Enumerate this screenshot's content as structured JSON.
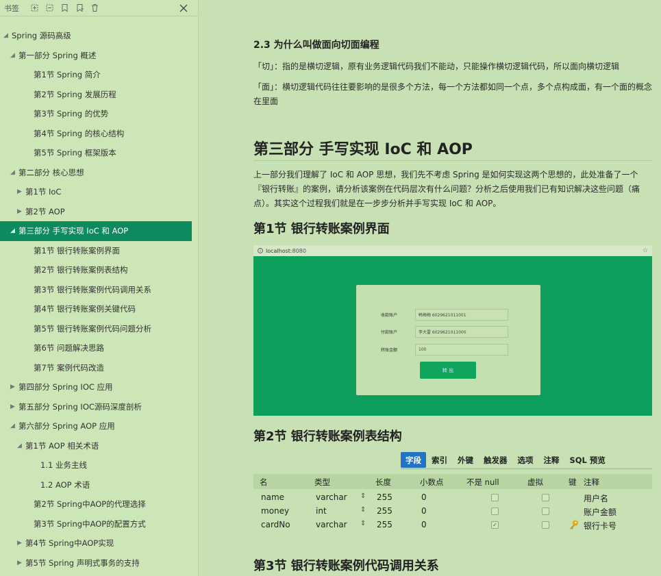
{
  "sidebar": {
    "title": "书签",
    "toolbar_icons": [
      "expand-all-icon",
      "collapse-all-icon",
      "add-bookmark-icon",
      "add-child-bookmark-icon",
      "delete-bookmark-icon"
    ],
    "items": [
      {
        "label": "Spring 源码高级",
        "caret": "◢",
        "level": "lvl0"
      },
      {
        "label": "第一部分 Spring 概述",
        "caret": "◢",
        "level": "lvl1"
      },
      {
        "label": "第1节 Spring 简介",
        "caret": "",
        "level": "lvl2"
      },
      {
        "label": "第2节 Spring 发展历程",
        "caret": "",
        "level": "lvl2"
      },
      {
        "label": "第3节 Spring 的优势",
        "caret": "",
        "level": "lvl2"
      },
      {
        "label": "第4节 Spring 的核心结构",
        "caret": "",
        "level": "lvl2"
      },
      {
        "label": "第5节 Spring 框架版本",
        "caret": "",
        "level": "lvl2"
      },
      {
        "label": "第二部分 核心思想",
        "caret": "◢",
        "level": "lvl1"
      },
      {
        "label": "第1节 IoC",
        "caret": "▶",
        "level": "lvl2c"
      },
      {
        "label": "第2节 AOP",
        "caret": "▶",
        "level": "lvl2c"
      },
      {
        "label": "第三部分 手写实现 IoC 和 AOP",
        "caret": "◢",
        "level": "lvl1",
        "active": true
      },
      {
        "label": "第1节 银行转账案例界面",
        "caret": "",
        "level": "lvl2"
      },
      {
        "label": "第2节 银行转账案例表结构",
        "caret": "",
        "level": "lvl2"
      },
      {
        "label": "第3节 银行转账案例代码调用关系",
        "caret": "",
        "level": "lvl2"
      },
      {
        "label": "第4节 银行转账案例关键代码",
        "caret": "",
        "level": "lvl2"
      },
      {
        "label": "第5节 银行转账案例代码问题分析",
        "caret": "",
        "level": "lvl2"
      },
      {
        "label": "第6节 问题解决思路",
        "caret": "",
        "level": "lvl2"
      },
      {
        "label": "第7节 案例代码改造",
        "caret": "",
        "level": "lvl2"
      },
      {
        "label": "第四部分 Spring IOC 应用",
        "caret": "▶",
        "level": "lvl1"
      },
      {
        "label": "第五部分 Spring IOC源码深度剖析",
        "caret": "▶",
        "level": "lvl1"
      },
      {
        "label": "第六部分 Spring AOP 应用",
        "caret": "◢",
        "level": "lvl1"
      },
      {
        "label": "第1节 AOP 相关术语",
        "caret": "◢",
        "level": "lvl2c"
      },
      {
        "label": "1.1 业务主线",
        "caret": "",
        "level": "lvl3"
      },
      {
        "label": "1.2 AOP 术语",
        "caret": "",
        "level": "lvl3"
      },
      {
        "label": "第2节 Spring中AOP的代理选择",
        "caret": "",
        "level": "lvl2"
      },
      {
        "label": "第3节 Spring中AOP的配置方式",
        "caret": "",
        "level": "lvl2"
      },
      {
        "label": "第4节 Spring中AOP实现",
        "caret": "▶",
        "level": "lvl2c"
      },
      {
        "label": "第5节 Spring 声明式事务的支持",
        "caret": "▶",
        "level": "lvl2c"
      }
    ]
  },
  "content": {
    "sec23_title": "2.3 为什么叫做面向切面编程",
    "sec23_p1": "「切」：指的是横切逻辑，原有业务逻辑代码我们不能动，只能操作横切逻辑代码，所以面向横切逻辑",
    "sec23_p2": "「面」：横切逻辑代码往往要影响的是很多个方法，每一个方法都如同一个点，多个点构成面，有一个面的概念在里面",
    "part3_title": "第三部分 手写实现 IoC 和 AOP",
    "part3_intro": "上一部分我们理解了 IoC 和 AOP 思想，我们先不考虑 Spring 是如何实现这两个思想的，此处准备了一个『银行转账』的案例，请分析该案例在代码层次有什么问题？分析之后使用我们已有知识解决这些问题（痛点）。其实这个过程我们就是在一步步分析并手写实现 IoC 和 AOP。",
    "sec1_title": "第1节 银行转账案例界面",
    "sec2_title": "第2节 银行转账案例表结构",
    "sec3_title": "第3节 银行转账案例代码调用关系"
  },
  "screenshot": {
    "url_host": "localhost",
    "url_port": ":8080",
    "fields": [
      {
        "label": "收款账户",
        "value": "韩梅梅 6029621011001"
      },
      {
        "label": "付款账户",
        "value": "李大雷 6029621011000"
      },
      {
        "label": "转账金额",
        "value": "100"
      }
    ],
    "button": "转 出"
  },
  "db": {
    "tabs": [
      "字段",
      "索引",
      "外键",
      "触发器",
      "选项",
      "注释",
      "SQL 预览"
    ],
    "headers": [
      "名",
      "类型",
      "长度",
      "小数点",
      "不是 null",
      "虚拟",
      "键",
      "注释"
    ],
    "rows": [
      {
        "name": "name",
        "type": "varchar",
        "length": "255",
        "decimal": "0",
        "notnull": false,
        "virtual": false,
        "key": false,
        "comment": "用户名"
      },
      {
        "name": "money",
        "type": "int",
        "length": "255",
        "decimal": "0",
        "notnull": false,
        "virtual": false,
        "key": false,
        "comment": "账户金额"
      },
      {
        "name": "cardNo",
        "type": "varchar",
        "length": "255",
        "decimal": "0",
        "notnull": true,
        "virtual": false,
        "key": true,
        "comment": "银行卡号"
      }
    ]
  },
  "colors": {
    "active_item": "#0e8a5f",
    "tab_active": "#2173c3",
    "screenshot_bg": "#0f9f5d"
  }
}
